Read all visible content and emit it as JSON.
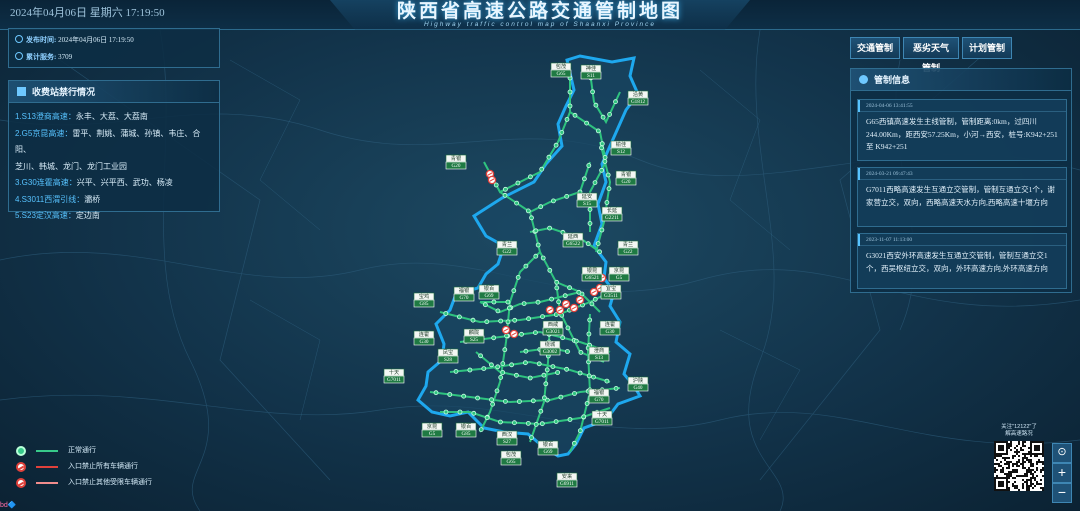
{
  "header": {
    "datetime": "2024年04月06日 星期六   17:19:50",
    "title": "陕西省高速公路交通管制地图",
    "subtitle": "Highway traffic control map of Shaanxi Province"
  },
  "info": {
    "publish_label": "发布时间:",
    "publish_value": "2024年04月06日 17:19:50",
    "service_label": "累计服务:",
    "service_value": "3709"
  },
  "toll": {
    "title": "收费站禁行情况",
    "items": [
      {
        "road": "1.S13澄商高速：",
        "stations": "永丰、大荔、大荔南"
      },
      {
        "road": "2.G5京昆高速：",
        "stations": "雷平、荆姚、蒲城、孙镇、韦庄、合阳、"
      },
      {
        "road": "",
        "stations": "芝川、韩城、龙门、龙门工业园"
      },
      {
        "road": "3.G30连霍高速：",
        "stations": "兴平、兴平西、武功、杨凌"
      },
      {
        "road": "4.S3011西渭引线：",
        "stations": "灞桥"
      },
      {
        "road": "5.S23定汉高速：",
        "stations": "定边南"
      }
    ]
  },
  "tabs": [
    "交通管制",
    "恶劣天气管制",
    "计划管制"
  ],
  "control": {
    "title": "管制信息",
    "items": [
      {
        "time": "2024-04-06 13:41:55",
        "text": "G65西镇高速发生主线管制，管制距离:0km，过四川244.00Km，距西安57.25Km，小河→西安，桩号:K942+251 至 K942+251"
      },
      {
        "time": "2024-03-21 09:47:43",
        "text": "G7011西略高速发生互通立交管制，管制互通立交1个，谢家营立交，双向，西略高速天水方向,西略高速十堰方向"
      },
      {
        "time": "2023-11-07 11:13:00",
        "text": "G3021西安外环高速发生互通立交管制，管制互通立交1个，西吴枢纽立交，双向，外环高速方向,外环高速方向"
      }
    ]
  },
  "legend": [
    {
      "label": "正常通行",
      "line_color": "#37c98a"
    },
    {
      "label": "入口禁止所有车辆通行",
      "line_color": "#e0413b"
    },
    {
      "label": "入口禁止其他受限车辆通行",
      "line_color": "#f08c8c"
    }
  ],
  "qr": {
    "caption_1": "关注\"12122\"了",
    "caption_2": "解高速路况"
  },
  "zoom": {
    "locate": "⊙",
    "in": "+",
    "out": "−"
  },
  "footer_logo": "bd🔷",
  "map": {
    "road_color": "#2fc37f",
    "border_color": "#1ea8ee",
    "plates": [
      {
        "name": "包茂",
        "code": "G65"
      },
      {
        "name": "神佳",
        "code": "S11"
      },
      {
        "name": "沿黄",
        "code": "G1812"
      },
      {
        "name": "榆佳",
        "code": "S12"
      },
      {
        "name": "青银",
        "code": "G20"
      },
      {
        "name": "青银",
        "code": "G20"
      },
      {
        "name": "延安",
        "code": "S15"
      },
      {
        "name": "长延",
        "code": "G2211"
      },
      {
        "name": "延西",
        "code": "G6522"
      },
      {
        "name": "青兰",
        "code": "G22"
      },
      {
        "name": "青兰",
        "code": "G22"
      },
      {
        "name": "银昆",
        "code": "G6521"
      },
      {
        "name": "京昆",
        "code": "G5"
      },
      {
        "name": "宜宝",
        "code": "G3511"
      },
      {
        "name": "福银",
        "code": "G70"
      },
      {
        "name": "银百",
        "code": "G69"
      },
      {
        "name": "宝鸡",
        "code": "G85"
      },
      {
        "name": "西咸",
        "code": "G3021"
      },
      {
        "name": "连霍",
        "code": "G30"
      },
      {
        "name": "连霍",
        "code": "G30"
      },
      {
        "name": "麟陇",
        "code": "S25"
      },
      {
        "name": "绕城",
        "code": "G3002"
      },
      {
        "name": "凤宝",
        "code": "S28"
      },
      {
        "name": "澄商",
        "code": "S13"
      },
      {
        "name": "十天",
        "code": "G7011"
      },
      {
        "name": "沪陕",
        "code": "G40"
      },
      {
        "name": "福银",
        "code": "G70"
      },
      {
        "name": "十天",
        "code": "G7011"
      },
      {
        "name": "京昆",
        "code": "G5"
      },
      {
        "name": "银百",
        "code": "G85"
      },
      {
        "name": "西汉",
        "code": "S27"
      },
      {
        "name": "包茂",
        "code": "G65"
      },
      {
        "name": "银百",
        "code": "G69"
      },
      {
        "name": "安来",
        "code": "G6911"
      }
    ]
  }
}
